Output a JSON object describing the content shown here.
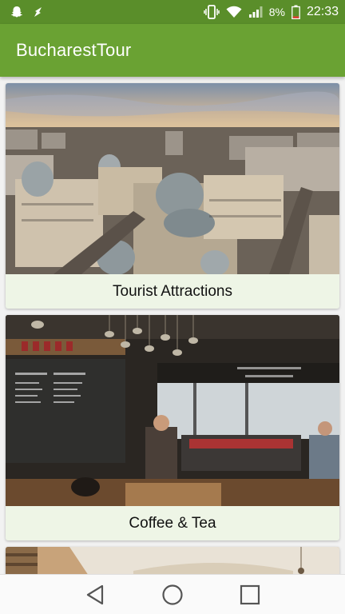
{
  "status_bar": {
    "battery_percent": "8%",
    "time": "22:33"
  },
  "app_bar": {
    "title": "BucharestTour"
  },
  "cards": [
    {
      "label": "Tourist Attractions"
    },
    {
      "label": "Coffee & Tea"
    },
    {
      "label": ""
    }
  ],
  "colors": {
    "status_bar": "#5a8e2a",
    "app_bar": "#6aa233",
    "card_label_bg": "#eef5e6"
  },
  "icons": {
    "status_left": [
      "snapchat-icon",
      "notification-icon"
    ],
    "status_right": [
      "vibrate-icon",
      "wifi-icon",
      "signal-icon",
      "battery-icon"
    ],
    "nav": [
      "back-icon",
      "home-icon",
      "recents-icon"
    ]
  }
}
